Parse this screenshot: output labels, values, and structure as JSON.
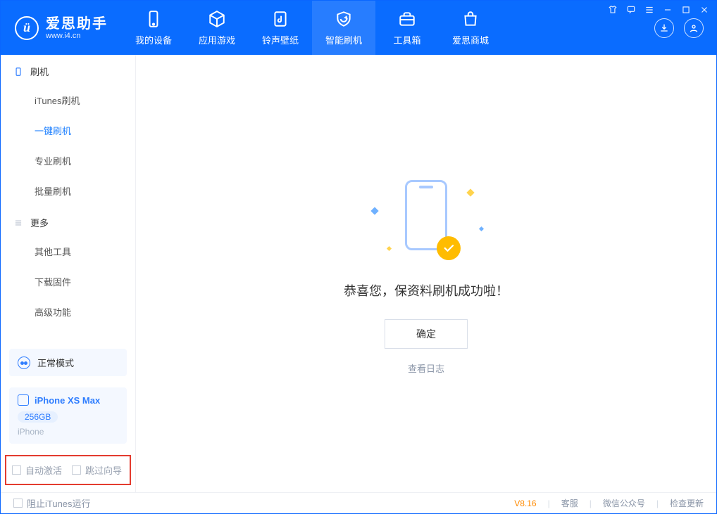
{
  "app": {
    "name_cn": "爱思助手",
    "name_en": "www.i4.cn",
    "logo_letter": "ü"
  },
  "nav": {
    "my_device": "我的设备",
    "apps_games": "应用游戏",
    "ringtone_wallpaper": "铃声壁纸",
    "smart_flash": "智能刷机",
    "toolbox": "工具箱",
    "store": "爱思商城"
  },
  "sidebar": {
    "group_flash": "刷机",
    "items_flash": [
      "iTunes刷机",
      "一键刷机",
      "专业刷机",
      "批量刷机"
    ],
    "group_more": "更多",
    "items_more": [
      "其他工具",
      "下载固件",
      "高级功能"
    ]
  },
  "status": {
    "mode_label": "正常模式"
  },
  "device": {
    "name": "iPhone XS Max",
    "storage": "256GB",
    "type": "iPhone"
  },
  "options": {
    "auto_activate": "自动激活",
    "skip_guide": "跳过向导"
  },
  "main": {
    "success_title": "恭喜您，保资料刷机成功啦！",
    "ok_button": "确定",
    "view_log": "查看日志"
  },
  "footer": {
    "block_itunes": "阻止iTunes运行",
    "version": "V8.16",
    "customer_service": "客服",
    "wechat": "微信公众号",
    "check_update": "检查更新"
  }
}
